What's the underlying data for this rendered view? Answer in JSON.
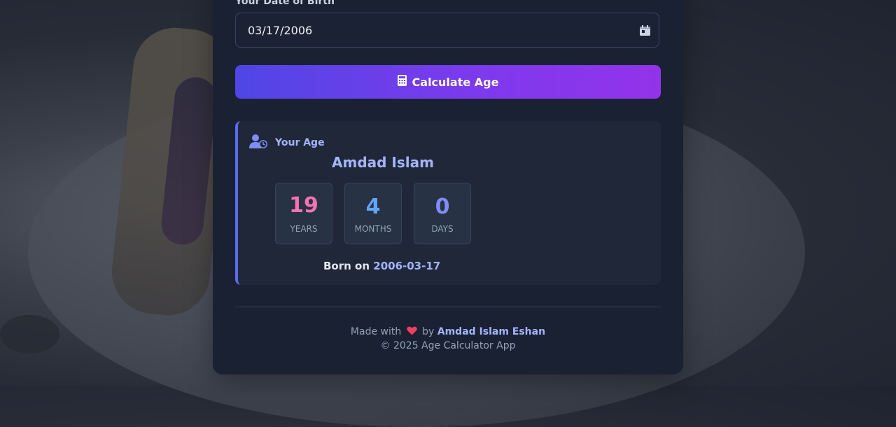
{
  "form": {
    "dob_label": "Your Date of Birth",
    "dob_value": "03/17/2006"
  },
  "calculate_button": {
    "label": "Calculate Age",
    "icon": "calculator-icon"
  },
  "result": {
    "heading": "Your Age",
    "heading_icon": "user-clock-icon",
    "name": "Amdad Islam",
    "years": {
      "value": "19",
      "label": "YEARS",
      "color": "#f472b6"
    },
    "months": {
      "value": "4",
      "label": "MONTHS",
      "color": "#60a5fa"
    },
    "days": {
      "value": "0",
      "label": "DAYS",
      "color": "#818cf8"
    },
    "born_prefix": "Born on",
    "born_date": "2006-03-17"
  },
  "footer": {
    "made_with": "Made with",
    "heart_icon": "heart-icon",
    "by": "by",
    "author": "Amdad Islam Eshan",
    "copyright": "© 2025 Age Calculator App"
  },
  "colors": {
    "accent": "#a5b4fc",
    "button_gradient_start": "#4f46e5",
    "button_gradient_end": "#9333ea",
    "heart": "#f43f5e"
  }
}
